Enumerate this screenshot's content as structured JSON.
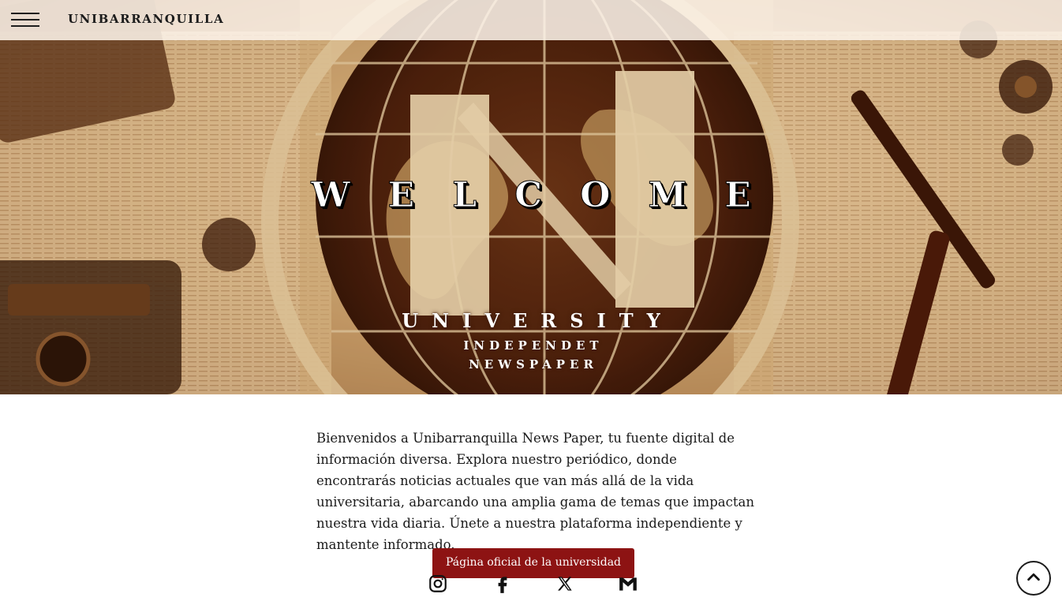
{
  "header": {
    "brand": "UNIBARRANQUILLA",
    "menu_icon": "hamburger-menu-icon"
  },
  "hero": {
    "title": "WELCOME",
    "subtitle": "UNIVERSITY",
    "line1": "INDEPENDET",
    "line2": "NEWSPAPER",
    "image_description_colors": {
      "sepia_light": "#f1d9b0",
      "sepia_dark": "#5b3016"
    }
  },
  "main": {
    "intro": "Bienvenidos a Unibarranquilla News Paper, tu fuente digital de información diversa. Explora nuestro periódico, donde encontrarás noticias actuales que van más allá de la vida universitaria, abarcando una amplia gama de temas que impactan nuestra vida diaria. Únete a nuestra plataforma independiente y mantente informado.",
    "cta_label": "Página oficial de la universidad"
  },
  "social": [
    {
      "icon": "instagram-icon"
    },
    {
      "icon": "facebook-icon"
    },
    {
      "icon": "x-twitter-icon"
    },
    {
      "icon": "gmail-icon"
    }
  ],
  "scroll_top_icon": "chevron-up-icon",
  "colors": {
    "cta_bg": "#8d1313",
    "topbar_bg": "#fcf3e8",
    "text": "#1a1a1a"
  }
}
